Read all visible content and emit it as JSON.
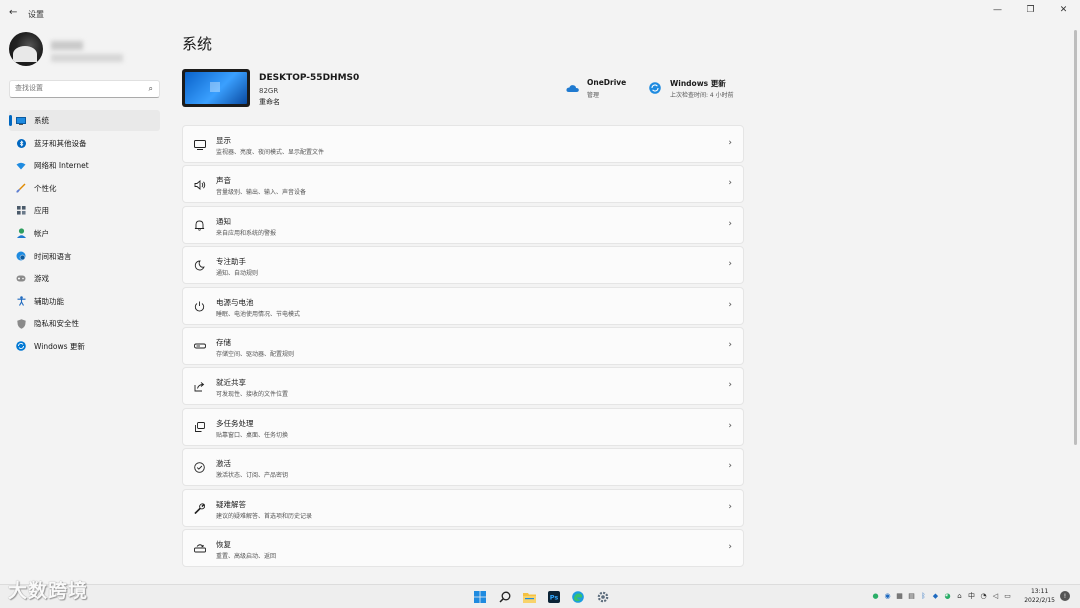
{
  "window": {
    "title": "设置",
    "back_icon": "back-arrow-icon"
  },
  "sidebar": {
    "search_placeholder": "查找设置",
    "items": [
      {
        "label": "系统",
        "icon": "monitor-icon",
        "color": "#0078d4",
        "active": true
      },
      {
        "label": "蓝牙和其他设备",
        "icon": "bluetooth-icon",
        "color": "#0067c0"
      },
      {
        "label": "网络和 Internet",
        "icon": "wifi-icon",
        "color": "#0078d4"
      },
      {
        "label": "个性化",
        "icon": "brush-icon",
        "color": "#e08a00"
      },
      {
        "label": "应用",
        "icon": "apps-icon",
        "color": "#4a5a6a"
      },
      {
        "label": "帐户",
        "icon": "person-icon",
        "color": "#2f9e5f"
      },
      {
        "label": "时间和语言",
        "icon": "clock-globe-icon",
        "color": "#0078d4"
      },
      {
        "label": "游戏",
        "icon": "gamepad-icon",
        "color": "#666666"
      },
      {
        "label": "辅助功能",
        "icon": "accessibility-icon",
        "color": "#0078d4"
      },
      {
        "label": "隐私和安全性",
        "icon": "shield-icon",
        "color": "#707070"
      },
      {
        "label": "Windows 更新",
        "icon": "update-icon",
        "color": "#0078d4"
      }
    ]
  },
  "main": {
    "title": "系统",
    "device": {
      "name": "DESKTOP-55DHMS0",
      "model": "82GR",
      "rename": "重命名"
    },
    "quick": [
      {
        "title": "OneDrive",
        "sub": "管理",
        "icon": "cloud-icon"
      },
      {
        "title": "Windows 更新",
        "sub": "上次检查时间: 4 小时前",
        "icon": "update-icon"
      }
    ],
    "settings": [
      {
        "title": "显示",
        "desc": "监视器、亮度、夜间模式、显示配置文件",
        "icon": "display-icon"
      },
      {
        "title": "声音",
        "desc": "音量级别、输出、输入、声音设备",
        "icon": "speaker-icon"
      },
      {
        "title": "通知",
        "desc": "来自应用和系统的警报",
        "icon": "bell-icon"
      },
      {
        "title": "专注助手",
        "desc": "通知、自动规则",
        "icon": "moon-icon"
      },
      {
        "title": "电源与电池",
        "desc": "睡眠、电池使用情况、节电模式",
        "icon": "power-icon"
      },
      {
        "title": "存储",
        "desc": "存储空间、驱动器、配置规则",
        "icon": "storage-icon"
      },
      {
        "title": "就近共享",
        "desc": "可发现性、接收的文件位置",
        "icon": "share-icon"
      },
      {
        "title": "多任务处理",
        "desc": "贴靠窗口、桌面、任务切换",
        "icon": "multitask-icon"
      },
      {
        "title": "激活",
        "desc": "激活状态、订阅、产品密钥",
        "icon": "check-circle-icon"
      },
      {
        "title": "疑难解答",
        "desc": "建议的疑难解答、首选项和历史记录",
        "icon": "wrench-icon"
      },
      {
        "title": "恢复",
        "desc": "重置、高级启动、返回",
        "icon": "recovery-icon"
      }
    ]
  },
  "taskbar": {
    "apps": [
      "windows-start-icon",
      "search-icon",
      "file-explorer-icon",
      "photoshop-icon",
      "edge-icon",
      "settings-gear-icon"
    ],
    "ps_label": "Ps",
    "time": "13:11",
    "date": "2022/2/15"
  },
  "watermark": "大数跨境"
}
